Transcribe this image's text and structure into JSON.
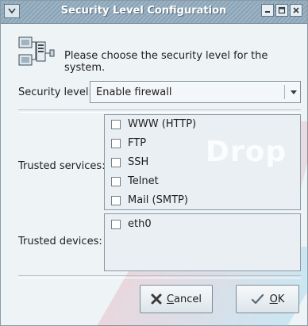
{
  "window": {
    "title": "Security Level Configuration"
  },
  "header": {
    "text": "Please choose the security level for the system.",
    "icon": "network-security-icon"
  },
  "security_level": {
    "label": "Security level:",
    "selected": "Enable firewall"
  },
  "trusted_services": {
    "label": "Trusted services:",
    "items": [
      {
        "label": "WWW (HTTP)",
        "checked": false
      },
      {
        "label": "FTP",
        "checked": false
      },
      {
        "label": "SSH",
        "checked": false
      },
      {
        "label": "Telnet",
        "checked": false
      },
      {
        "label": "Mail (SMTP)",
        "checked": false
      }
    ]
  },
  "trusted_devices": {
    "label": "Trusted devices:",
    "items": [
      {
        "label": "eth0",
        "checked": false
      }
    ]
  },
  "buttons": {
    "cancel_prefix": "",
    "cancel_mnemonic": "C",
    "cancel_rest": "ancel",
    "ok_mnemonic": "O",
    "ok_rest": "K"
  },
  "watermark": {
    "text": "Drop"
  },
  "colors": {
    "titlebar": "#9cb4c5",
    "window_bg": "#eef3f6",
    "watermark": "#d1344a"
  }
}
